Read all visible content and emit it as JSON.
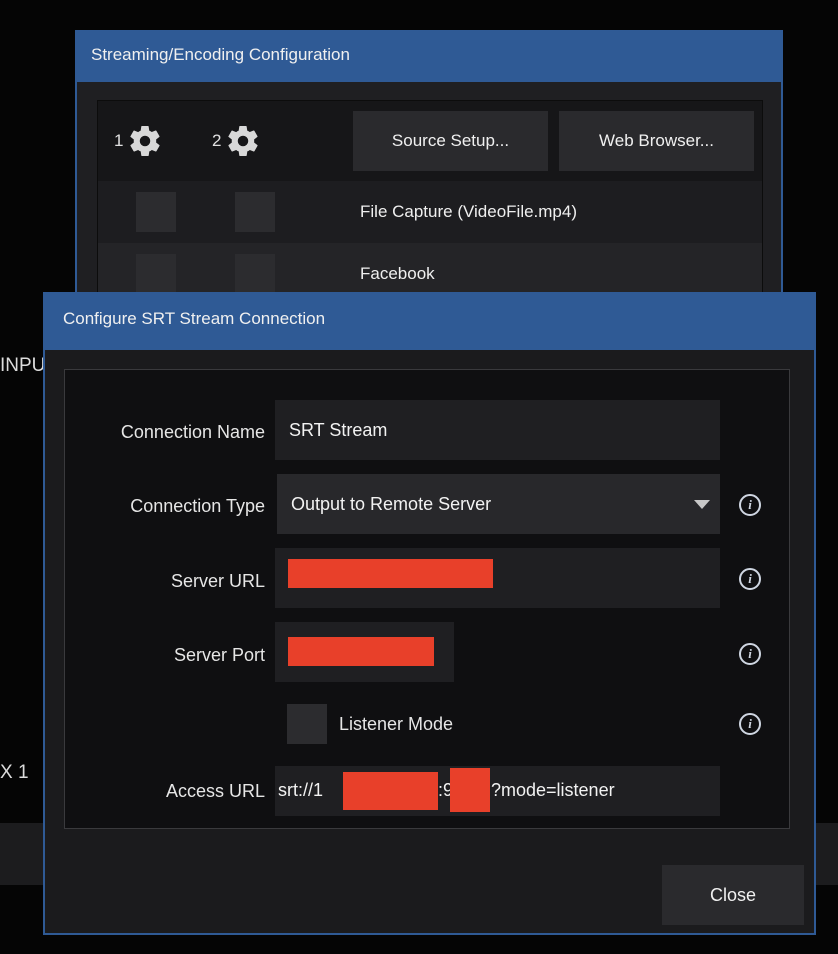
{
  "background": {
    "input_label": "INPU",
    "mix_label": "X 1"
  },
  "streaming_window": {
    "title": "Streaming/Encoding Configuration",
    "slot1_label": "1",
    "slot2_label": "2",
    "source_setup_label": "Source Setup...",
    "web_browser_label": "Web Browser...",
    "outputs": [
      {
        "label": "File Capture (VideoFile.mp4)"
      },
      {
        "label": "Facebook"
      }
    ]
  },
  "srt_window": {
    "title": "Configure SRT Stream Connection",
    "connection_name_label": "Connection Name",
    "connection_name_value": "SRT Stream",
    "connection_type_label": "Connection Type",
    "connection_type_value": "Output to Remote Server",
    "server_url_label": "Server URL",
    "server_port_label": "Server Port",
    "listener_mode_label": "Listener Mode",
    "access_url_label": "Access URL",
    "access_url_prefix": "srt://1",
    "access_url_mid": ":9",
    "access_url_suffix": "?mode=listener",
    "close_label": "Close"
  },
  "colors": {
    "accent": "#2f5a95",
    "redaction": "#e8402a"
  }
}
